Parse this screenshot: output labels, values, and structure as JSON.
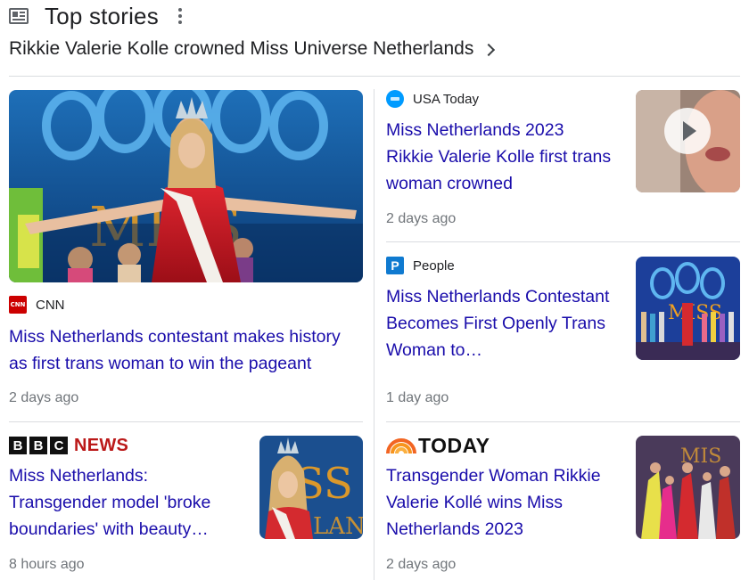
{
  "header": {
    "title": "Top stories",
    "headline_link": "Rikkie Valerie Kolle crowned Miss Universe Netherlands"
  },
  "stories": {
    "cnn": {
      "source": "CNN",
      "logo_text": "CNN",
      "title": "Miss Netherlands contestant makes history as first trans woman to win the pageant",
      "time": "2 days ago"
    },
    "usatoday": {
      "source": "USA Today",
      "title": "Miss Netherlands 2023 Rikkie Valerie Kolle first trans woman crowned",
      "time": "2 days ago",
      "has_video": true
    },
    "people": {
      "source": "People",
      "logo_text": "P",
      "title": "Miss Netherlands Contestant Becomes First Openly Trans Woman to…",
      "time": "1 day ago"
    },
    "bbc": {
      "logo_letters": [
        "B",
        "B",
        "C"
      ],
      "logo_news": "NEWS",
      "title": "Miss Netherlands: Transgender model 'broke boundaries' with beauty…",
      "time": "8 hours ago"
    },
    "today": {
      "logo_text": "TODAY",
      "title": "Transgender Woman Rikkie Valerie Kollé wins Miss Netherlands 2023",
      "time": "2 days ago"
    }
  },
  "colors": {
    "link": "#1a0dab",
    "meta": "#70757a",
    "divider": "#dadce0",
    "cnn_red": "#cc0000",
    "bbc_red": "#bb1919",
    "people_blue": "#0f7ad0",
    "usa_blue": "#009bff"
  },
  "icons": {
    "header": "news-icon",
    "menu": "more-vert-icon",
    "link": "chevron-right-icon",
    "video": "play-icon"
  }
}
